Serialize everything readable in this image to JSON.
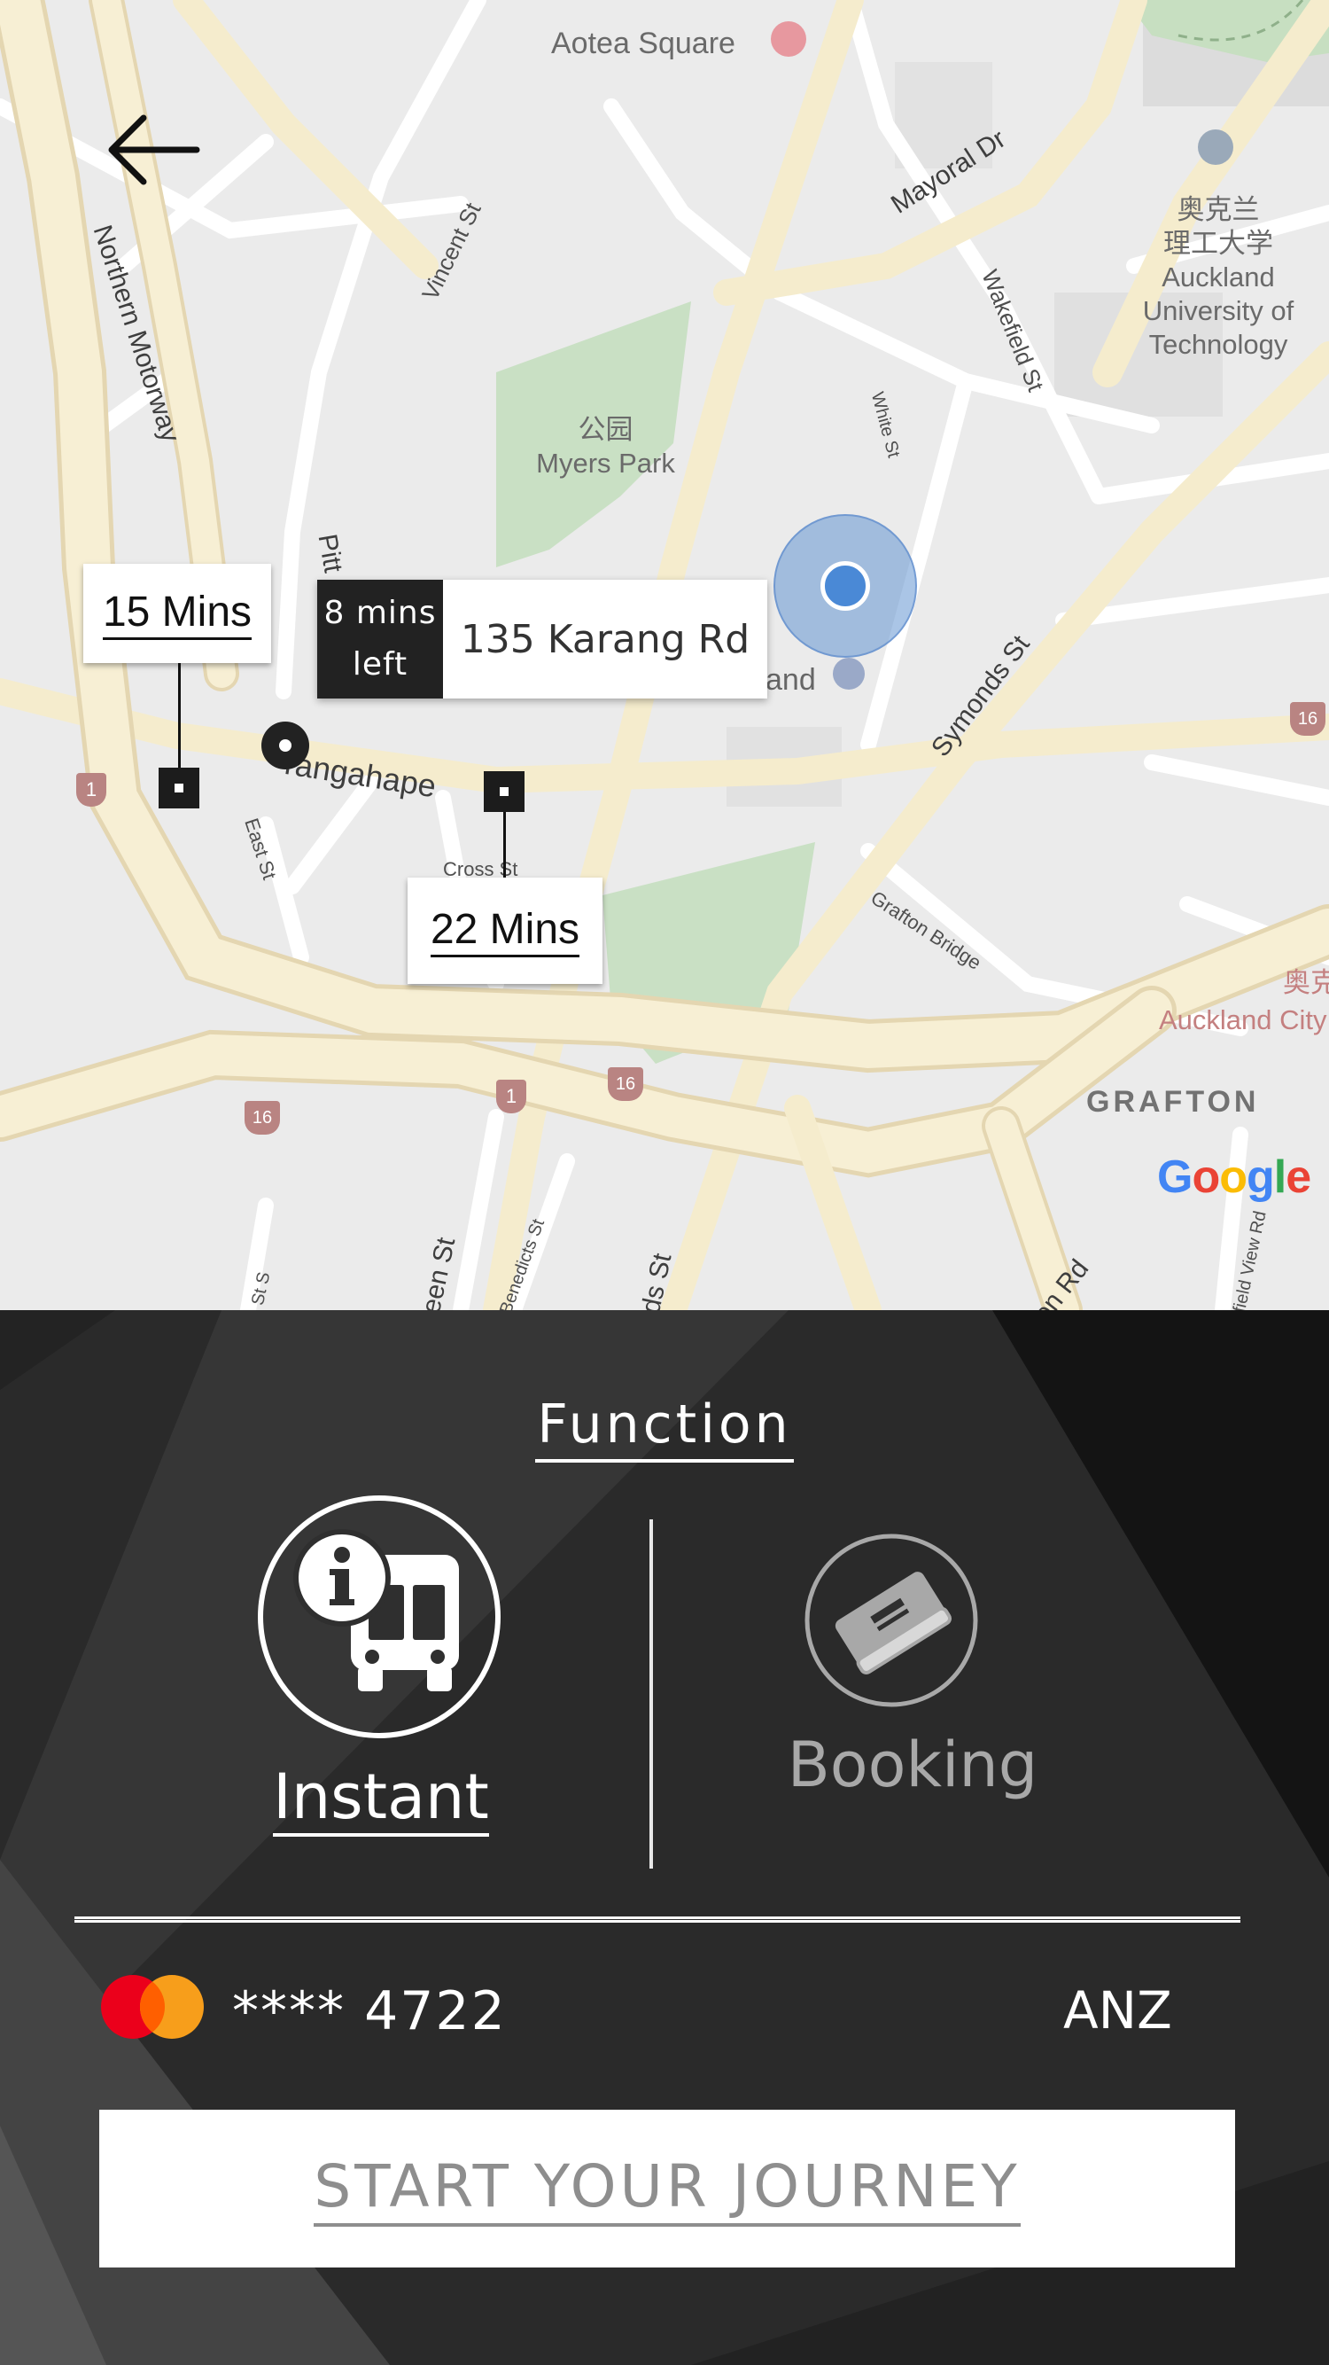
{
  "map": {
    "labels": {
      "aotea": "Aotea Square",
      "mayoral": "Mayoral Dr",
      "northern": "Northern Motorway",
      "vincent": "Vincent St",
      "aut_cn1": "奥克兰",
      "aut_cn2": "理工大学",
      "aut_en1": "Auckland",
      "aut_en2": "University of",
      "aut_en3": "Technology",
      "wakefield": "Wakefield St",
      "white": "White St",
      "myers_cn": "公园",
      "myers": "Myers Park",
      "pitt": "Pitt",
      "symonds": "Symonds St",
      "karangahape": "rangahape",
      "east": "East St",
      "cross": "Cross St",
      "grafton_bridge": "Grafton Bridge",
      "auckland_city_cn": "奥克",
      "auckland_city": "Auckland City",
      "grafton": "GRAFTON",
      "hotel_partial": "and",
      "queen_partial": "een St",
      "benedicts": "Benedicts St",
      "symonds2": "ds St",
      "st_small": "St S",
      "park_rd": "on Rd",
      "field_view": "field View Rd"
    },
    "shields": [
      "1",
      "1",
      "16",
      "16",
      "16"
    ],
    "google": [
      "G",
      "o",
      "o",
      "g",
      "l",
      "e"
    ],
    "google_colors": [
      "#4285F4",
      "#EA4335",
      "#FBBC05",
      "#4285F4",
      "#34A853",
      "#EA4335"
    ]
  },
  "markers": {
    "time_left": "15 Mins",
    "time_right": "22 Mins"
  },
  "destination": {
    "eta_line1": "8 mins",
    "eta_line2": "left",
    "address": "135 Karang Rd"
  },
  "panel": {
    "title": "Function",
    "instant_label": "Instant",
    "booking_label": "Booking",
    "card_masked": "**** 4722",
    "bank": "ANZ",
    "start_button": "START YOUR JOURNEY"
  },
  "colors": {
    "panel_bg": "#2a2a2a",
    "active": "#ffffff",
    "inactive": "#a8a8a8",
    "location_blue": "#4a89d6"
  }
}
